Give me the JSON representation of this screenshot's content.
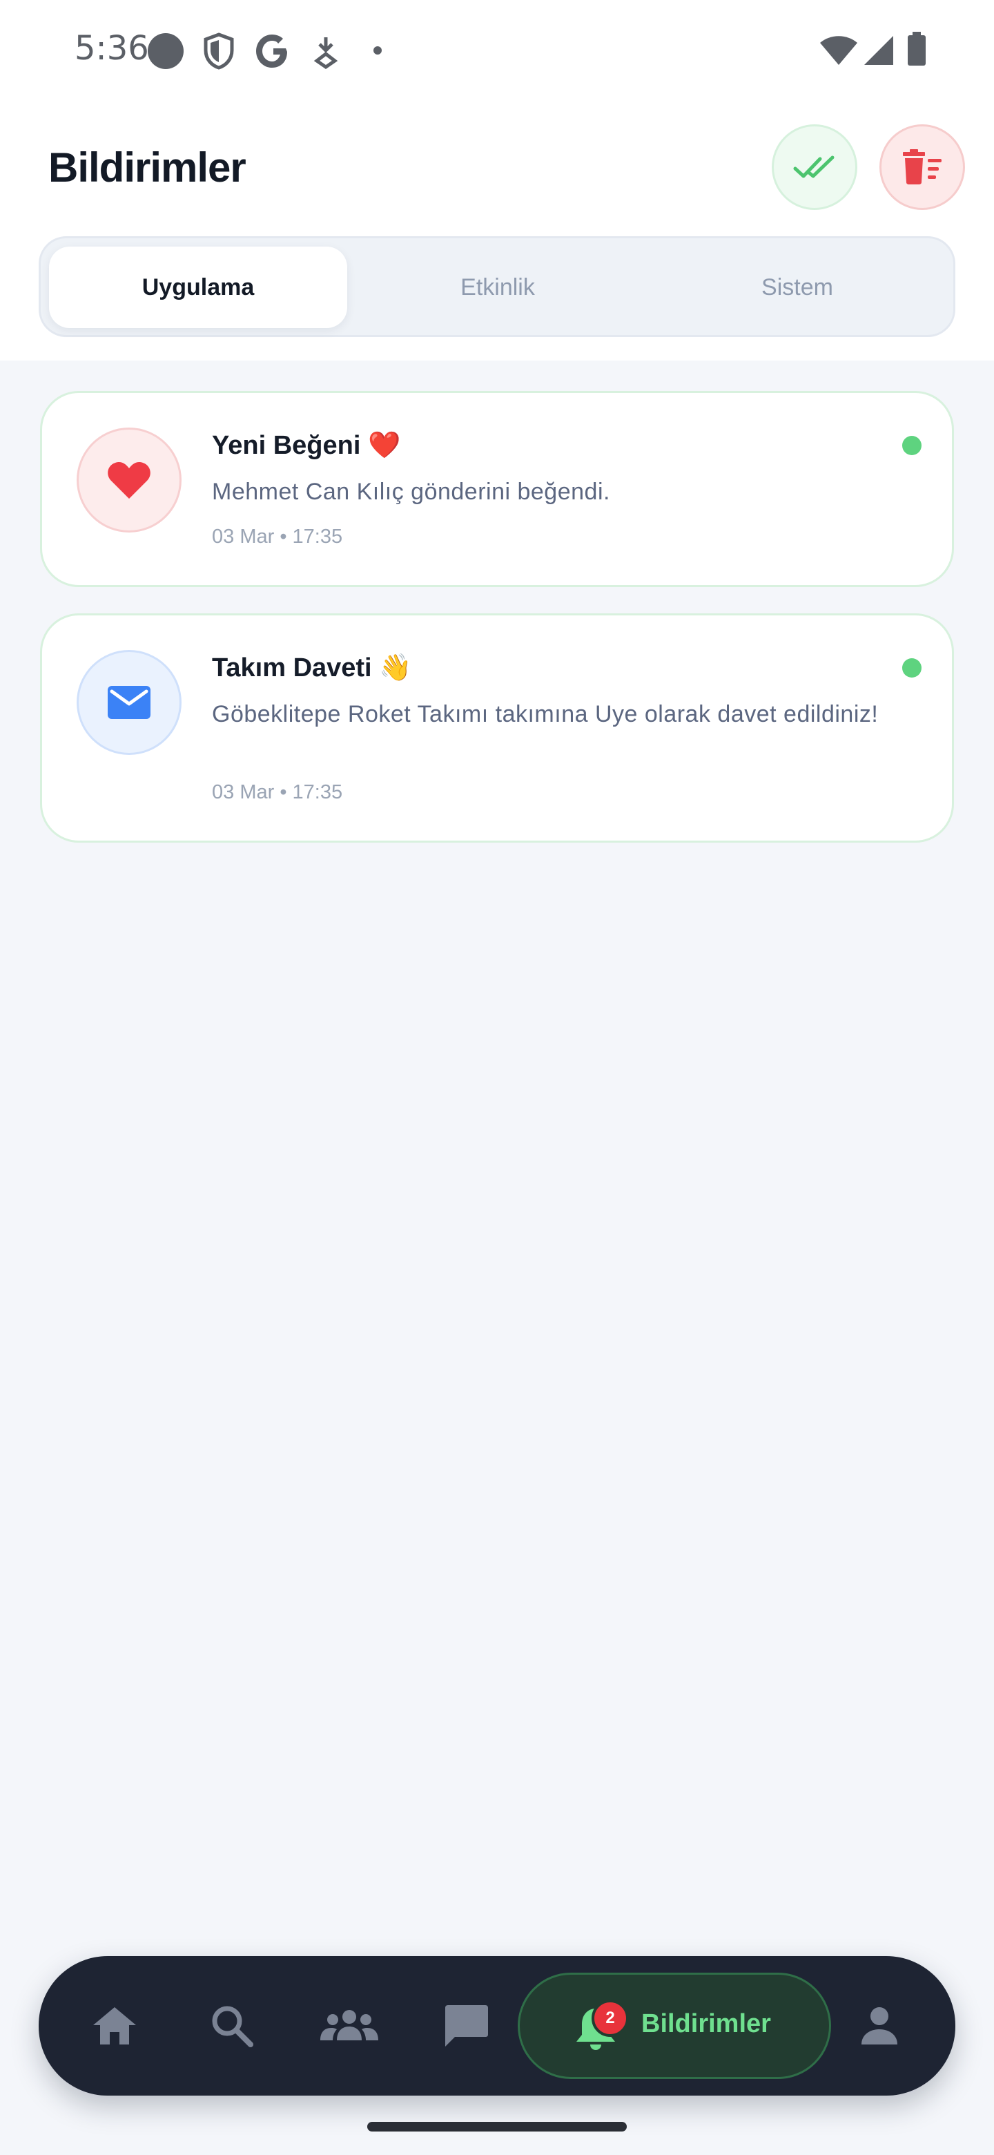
{
  "status_bar": {
    "time": "5:36"
  },
  "header": {
    "title": "Bildirimler",
    "actions": [
      {
        "name": "mark-all-read",
        "icon": "double-check-icon",
        "color": "#4cc46e"
      },
      {
        "name": "clear-all",
        "icon": "trash-list-icon",
        "color": "#e8434a"
      }
    ]
  },
  "tabs": [
    {
      "label": "Uygulama",
      "active": true
    },
    {
      "label": "Etkinlik",
      "active": false
    },
    {
      "label": "Sistem",
      "active": false
    }
  ],
  "notifications": [
    {
      "icon": "heart-icon",
      "title": "Yeni Beğeni ❤️",
      "message": "Mehmet Can Kılıç gönderini beğendi.",
      "time": "03 Mar • 17:35",
      "unread": true
    },
    {
      "icon": "mail-icon",
      "title": "Takım Daveti 👋",
      "message": "Göbeklitepe Roket Takımı takımına Uye olarak davet edildiniz!",
      "time": "03 Mar • 17:35",
      "unread": true
    }
  ],
  "bottom_nav": {
    "items": [
      "home-icon",
      "search-icon",
      "people-icon",
      "chat-icon",
      "bell-icon",
      "person-icon"
    ],
    "active_label": "Bildirimler",
    "badge_count": "2"
  },
  "colors": {
    "accent_green": "#5ed37f",
    "danger_red": "#e8434a",
    "nav_bg": "#1e2433"
  }
}
